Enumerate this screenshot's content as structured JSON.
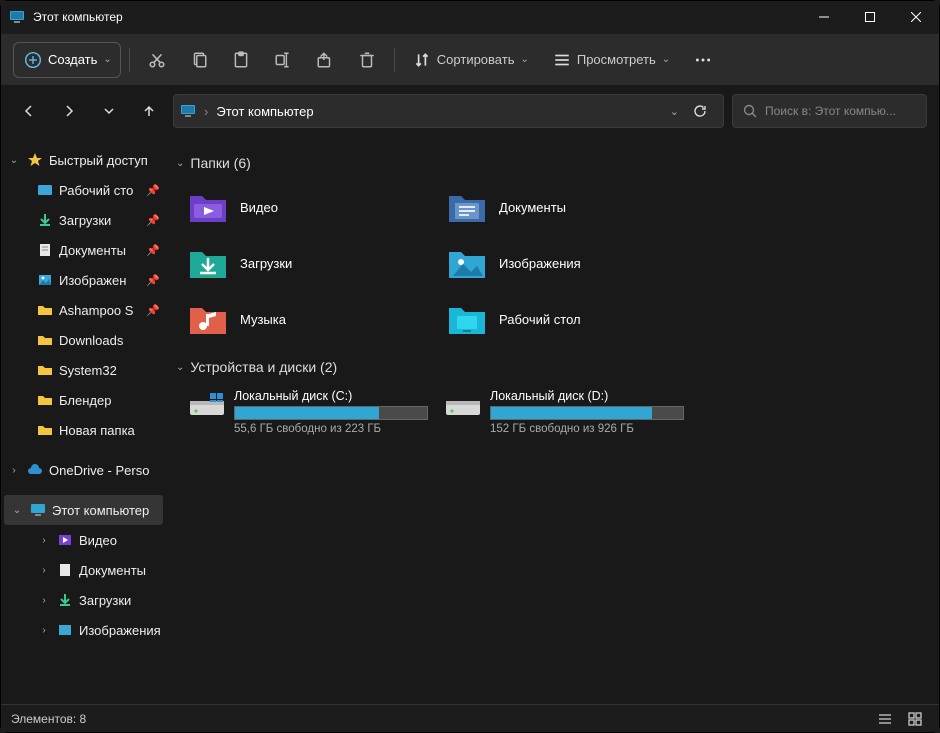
{
  "window": {
    "title": "Этот компьютер"
  },
  "toolbar": {
    "new_label": "Создать",
    "sort_label": "Сортировать",
    "view_label": "Просмотреть"
  },
  "address": {
    "root": "Этот компьютер"
  },
  "search": {
    "placeholder": "Поиск в: Этот компью..."
  },
  "sidebar": {
    "quick_access": "Быстрый доступ",
    "items": [
      {
        "label": "Рабочий сто"
      },
      {
        "label": "Загрузки"
      },
      {
        "label": "Документы"
      },
      {
        "label": "Изображен"
      },
      {
        "label": "Ashampoo S"
      },
      {
        "label": "Downloads"
      },
      {
        "label": "System32"
      },
      {
        "label": "Блендер"
      },
      {
        "label": "Новая папка"
      }
    ],
    "onedrive": "OneDrive - Perso",
    "this_pc": "Этот компьютер",
    "pc_children": [
      {
        "label": "Видео"
      },
      {
        "label": "Документы"
      },
      {
        "label": "Загрузки"
      },
      {
        "label": "Изображения"
      }
    ]
  },
  "groups": {
    "folders_title": "Папки (6)",
    "drives_title": "Устройства и диски (2)"
  },
  "folders": [
    {
      "label": "Видео"
    },
    {
      "label": "Документы"
    },
    {
      "label": "Загрузки"
    },
    {
      "label": "Изображения"
    },
    {
      "label": "Музыка"
    },
    {
      "label": "Рабочий стол"
    }
  ],
  "drives": [
    {
      "name": "Локальный диск (C:)",
      "free": "55,6 ГБ свободно из 223 ГБ",
      "pct": 75
    },
    {
      "name": "Локальный диск (D:)",
      "free": "152 ГБ свободно из 926 ГБ",
      "pct": 84
    }
  ],
  "status": {
    "text": "Элементов: 8"
  }
}
